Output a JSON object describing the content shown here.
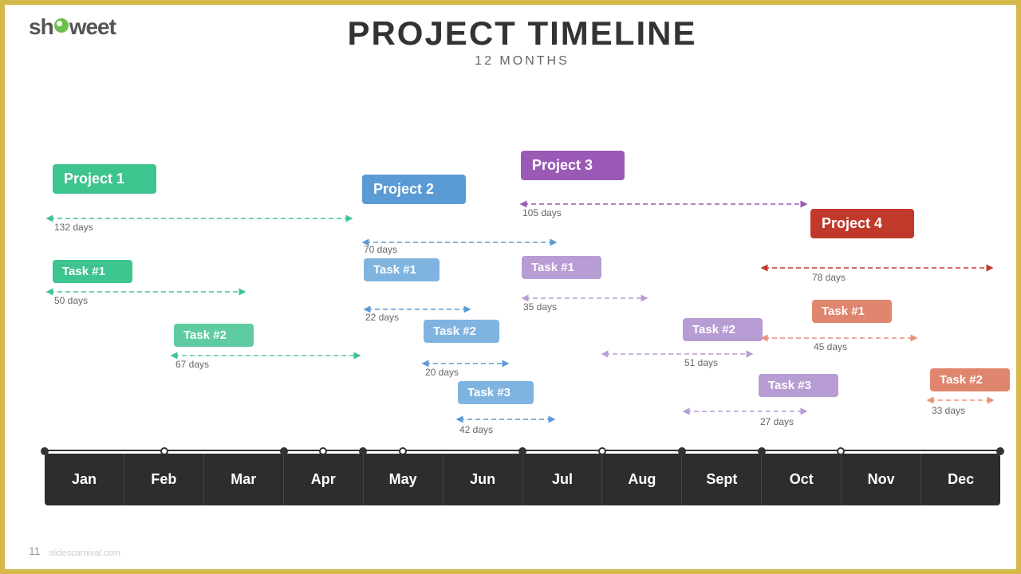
{
  "header": {
    "logo_sh": "sh",
    "logo_weet": "weet",
    "main_title": "Project Timeline",
    "subtitle": "12 Months"
  },
  "months": [
    "Jan",
    "Feb",
    "Mar",
    "Apr",
    "May",
    "Jun",
    "Jul",
    "Aug",
    "Sept",
    "Oct",
    "Nov",
    "Dec"
  ],
  "projects": [
    {
      "id": "p1",
      "label": "Project 1",
      "color": "#3dc48f",
      "duration": "132 days"
    },
    {
      "id": "p2",
      "label": "Project 2",
      "color": "#5b9bd5",
      "duration": "70 days"
    },
    {
      "id": "p3",
      "label": "Project 3",
      "color": "#9b59b6",
      "duration": "105 days"
    },
    {
      "id": "p4",
      "label": "Project 4",
      "color": "#c0392b",
      "duration": "78 days"
    }
  ],
  "tasks": {
    "p1": [
      {
        "label": "Task #1",
        "duration": "50 days"
      },
      {
        "label": "Task #2",
        "duration": "67 days"
      }
    ],
    "p2": [
      {
        "label": "Task #1",
        "duration": "22 days"
      },
      {
        "label": "Task #2",
        "duration": "20 days"
      },
      {
        "label": "Task #3",
        "duration": "42 days"
      }
    ],
    "p3": [
      {
        "label": "Task #1",
        "duration": "35 days"
      },
      {
        "label": "Task #2",
        "duration": "51 days"
      },
      {
        "label": "Task #3",
        "duration": "27 days"
      }
    ],
    "p4": [
      {
        "label": "Task #1",
        "duration": "45 days"
      },
      {
        "label": "Task #2",
        "duration": "33 days"
      }
    ]
  },
  "page_number": "11"
}
